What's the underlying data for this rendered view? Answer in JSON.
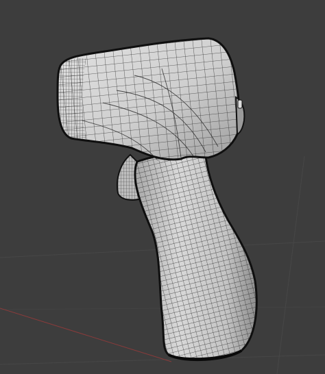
{
  "viewport": {
    "background_color": "#3d3d3d",
    "grid_color": "#474747",
    "x_axis_color": "#8a3b3b",
    "object": {
      "shading": "wireframe-on-solid",
      "base_color": "#c8c8c8",
      "wire_color": "#1a1a1a",
      "shape": "thermometer-gun"
    }
  }
}
